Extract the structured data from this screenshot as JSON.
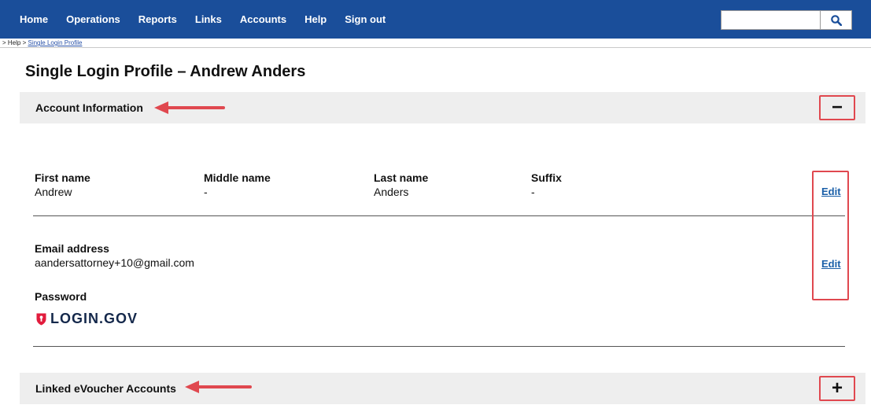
{
  "nav": {
    "items": [
      "Home",
      "Operations",
      "Reports",
      "Links",
      "Accounts",
      "Help",
      "Sign out"
    ],
    "search_value": ""
  },
  "breadcrumb": {
    "prefix": "> Help >",
    "current": "Single Login Profile"
  },
  "page_title": "Single Login Profile – Andrew Anders",
  "account_section": {
    "label": "Account Information",
    "toggle_symbol": "−",
    "name_fields": [
      {
        "label": "First name",
        "value": "Andrew"
      },
      {
        "label": "Middle name",
        "value": "-"
      },
      {
        "label": "Last name",
        "value": "Anders"
      },
      {
        "label": "Suffix",
        "value": "-"
      }
    ],
    "edit_label": "Edit",
    "email": {
      "label": "Email address",
      "value": "aandersattorney+10@gmail.com"
    },
    "password": {
      "label": "Password",
      "provider": "LOGIN.GOV"
    }
  },
  "linked_section": {
    "label": "Linked eVoucher Accounts",
    "toggle_symbol": "+"
  },
  "colors": {
    "nav_bg": "#1a4e9a",
    "highlight_red": "#e0484f",
    "link_blue": "#1a5fa8",
    "section_bg": "#eeeeee"
  }
}
